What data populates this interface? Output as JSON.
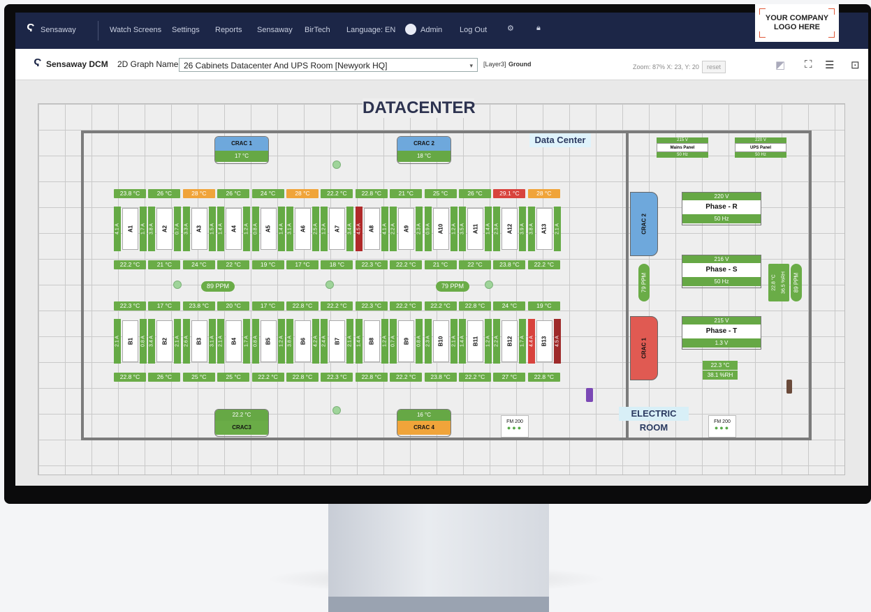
{
  "topnav": {
    "brand": "Sensaway",
    "items": [
      "Watch Screens",
      "Settings",
      "Reports",
      "Sensaway",
      "BirTech",
      "Language: EN"
    ],
    "user": "Admin",
    "logout": "Log Out",
    "logo_lines": [
      "YOUR COMPANY",
      "LOGO HERE"
    ]
  },
  "toolbar": {
    "app_name": "Sensaway DCM",
    "graph_label": "2D Graph Name :",
    "graph_value": "26 Cabinets Datacenter  And UPS Room [Newyork HQ]",
    "layer_prefix": "[Layer3]",
    "layer_name": "Ground",
    "zoom_text": "Zoom: 87% X: 23, Y: 20",
    "reset_label": "reset"
  },
  "floor": {
    "title": "DATACENTER",
    "data_center_label": "Data Center",
    "electric_room_label": "ELECTRIC ROOM",
    "cracs": [
      {
        "name": "CRAC 1",
        "temp": "17 °C",
        "color": "#6ea8dc"
      },
      {
        "name": "CRAC 2",
        "temp": "18 °C",
        "color": "#6ea8dc"
      },
      {
        "name": "CRAC3",
        "temp": "22.2 °C",
        "color": "#6aac47"
      },
      {
        "name": "CRAC 4",
        "temp": "16 °C",
        "color": "#f0a43a"
      }
    ],
    "row_a_top_temps": [
      "23.8 °C",
      "26 °C",
      "28 °C",
      "26 °C",
      "24 °C",
      "28 °C",
      "22.2 °C",
      "22.8 °C",
      "21 °C",
      "25 °C",
      "26 °C",
      "29.1 °C",
      "28 °C"
    ],
    "row_a_top_status": [
      "g",
      "g",
      "o",
      "g",
      "g",
      "o",
      "g",
      "g",
      "g",
      "g",
      "g",
      "r",
      "o"
    ],
    "row_a_cabinets": [
      {
        "name": "A1",
        "l": "4.1 A",
        "r": "1.7 A"
      },
      {
        "name": "A2",
        "l": "3.8 A",
        "r": "0.7 A"
      },
      {
        "name": "A3",
        "l": "3.3 A",
        "r": "1.5 A"
      },
      {
        "name": "A4",
        "l": "1.4 A",
        "r": "1.2 A"
      },
      {
        "name": "A5",
        "l": "0.8 A",
        "r": "1.4 A"
      },
      {
        "name": "A6",
        "l": "3.1 A",
        "r": "2.5 A"
      },
      {
        "name": "A7",
        "l": "1.2 A",
        "r": "3.4 A"
      },
      {
        "name": "A8",
        "l": "4.5 A",
        "r": "4.1 A"
      },
      {
        "name": "A9",
        "l": "2.2 A",
        "r": "2.3 A"
      },
      {
        "name": "A10",
        "l": "0.9 A",
        "r": "1.2 A"
      },
      {
        "name": "A11",
        "l": "3.5 A",
        "r": "1.4 A"
      },
      {
        "name": "A12",
        "l": "2.3 A",
        "r": "3.9 A"
      },
      {
        "name": "A13",
        "l": "3.8 A",
        "r": "2.1 A"
      }
    ],
    "row_a_bottom_temps": [
      "22.2 °C",
      "21 °C",
      "24 °C",
      "22 °C",
      "19 °C",
      "17 °C",
      "18 °C",
      "22.3 °C",
      "22.2 °C",
      "21 °C",
      "22 °C",
      "23.8 °C",
      "22.2 °C"
    ],
    "aisle_ppm": [
      "89 PPM",
      "79 PPM"
    ],
    "row_b_top_temps": [
      "22.3 °C",
      "17 °C",
      "23.8 °C",
      "20 °C",
      "17 °C",
      "22.8 °C",
      "22.2 °C",
      "22.3 °C",
      "22.2 °C",
      "22.2 °C",
      "22.8 °C",
      "24 °C",
      "19 °C"
    ],
    "row_b_cabinets": [
      {
        "name": "B1",
        "l": "2.1 A",
        "r": "0.8 A"
      },
      {
        "name": "B2",
        "l": "3.4 A",
        "r": "2.1 A"
      },
      {
        "name": "B3",
        "l": "2.6 A",
        "r": "3.1 A"
      },
      {
        "name": "B4",
        "l": "2.1 A",
        "r": "1.7 A"
      },
      {
        "name": "B5",
        "l": "0.8 A",
        "r": "1.2 A"
      },
      {
        "name": "B6",
        "l": "3.8 A",
        "r": "4.2 A"
      },
      {
        "name": "B7",
        "l": "2.4 A",
        "r": "2.1 A"
      },
      {
        "name": "B8",
        "l": "1.4 A",
        "r": "1.2 A"
      },
      {
        "name": "B9",
        "l": "0.7 A",
        "r": "0.8 A"
      },
      {
        "name": "B10",
        "l": "2.3 A",
        "r": "2.1 A"
      },
      {
        "name": "B11",
        "l": "1.4 A",
        "r": "1.2 A"
      },
      {
        "name": "B12",
        "l": "2.2 A",
        "r": "1.7 A"
      },
      {
        "name": "B13",
        "l": "4.4 A",
        "r": "4.5 A"
      }
    ],
    "row_b_bottom_temps": [
      "22.8 °C",
      "26 °C",
      "25 °C",
      "25 °C",
      "22.2 °C",
      "22.8 °C",
      "22.3 °C",
      "22.8 °C",
      "22.2 °C",
      "23.8 °C",
      "22.2 °C",
      "27 °C",
      "22.8 °C"
    ],
    "fm_label": "FM 200",
    "electric": {
      "mains": {
        "v": "215 V",
        "name": "Mains Panel",
        "hz": "50 Hz"
      },
      "ups": {
        "v": "220 V",
        "name": "UPS Panel",
        "hz": "50 Hz"
      },
      "phases": [
        {
          "v": "220 V",
          "name": "Phase - R",
          "bot": "50 Hz"
        },
        {
          "v": "216 V",
          "name": "Phase - S",
          "bot": "50 Hz"
        },
        {
          "v": "215 V",
          "name": "Phase - T",
          "bot": "1.3 V"
        }
      ],
      "crac2": {
        "name": "CRAC 2",
        "color": "#6ea8dc"
      },
      "crac1": {
        "name": "CRAC 1",
        "color": "#e05a52"
      },
      "ppm_left": "79 PPM",
      "ppm_right": "89 PPM",
      "hum_side": [
        "22.8 °C",
        "36.5 %RH"
      ],
      "hum_temp": "22.3 °C",
      "hum_rh": "38.1 %RH"
    }
  }
}
